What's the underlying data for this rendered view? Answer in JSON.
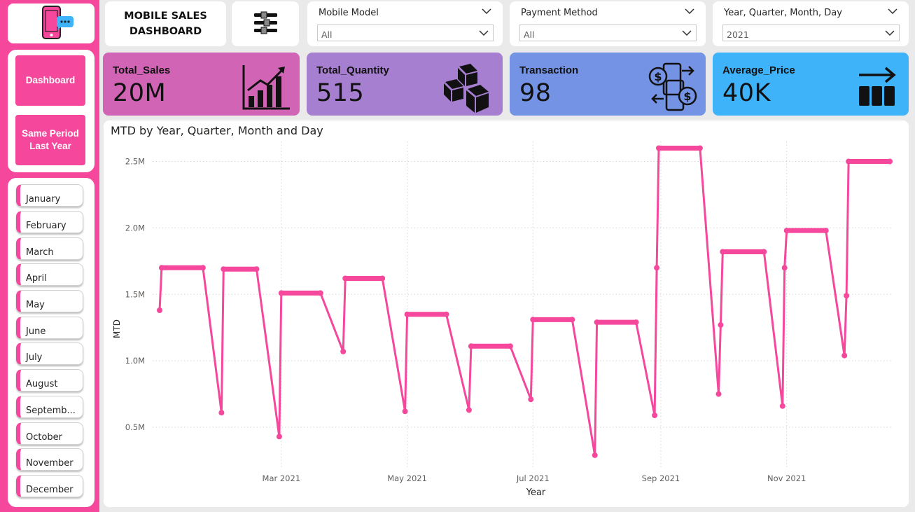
{
  "header": {
    "title_line1": "MOBILE SALES",
    "title_line2": "DASHBOARD"
  },
  "nav": {
    "dashboard_label": "Dashboard",
    "same_period_label": "Same Period Last Year"
  },
  "months": [
    "January",
    "February",
    "March",
    "April",
    "May",
    "June",
    "July",
    "August",
    "Septemb...",
    "October",
    "November",
    "December"
  ],
  "slicers": [
    {
      "title": "Mobile Model",
      "value": "All"
    },
    {
      "title": "Payment Method",
      "value": "All"
    },
    {
      "title": "Year, Quarter, Month, Day",
      "value": "2021"
    }
  ],
  "kpis": [
    {
      "label": "Total_Sales",
      "value": "20M",
      "color": "#d264b6",
      "icon": "bar-growth-chart-icon"
    },
    {
      "label": "Total_Quantity",
      "value": "515",
      "color": "#a77fd0",
      "icon": "boxes-icon"
    },
    {
      "label": "Transaction",
      "value": "98",
      "color": "#7593e5",
      "icon": "money-transfer-icon"
    },
    {
      "label": "Average_Price",
      "value": "40K",
      "color": "#3fb3f9",
      "icon": "arrow-bars-icon"
    }
  ],
  "colors": {
    "sidebar": "#f5489c",
    "line": "#f5489c"
  },
  "chart_data": {
    "type": "line",
    "title": "MTD by Year, Quarter, Month and Day",
    "xlabel": "Year",
    "ylabel": "MTD",
    "x_ticks": [
      "Mar 2021",
      "May 2021",
      "Jul 2021",
      "Sep 2021",
      "Nov 2021"
    ],
    "y_ticks": [
      "0.5M",
      "1.0M",
      "1.5M",
      "2.0M",
      "2.5M"
    ],
    "ylim": [
      0.2,
      2.65
    ],
    "grid": true,
    "series": [
      {
        "points": [
          [
            "2021-01-01",
            1.38
          ],
          [
            "2021-01-02",
            1.7
          ],
          [
            "2021-01-22",
            1.7
          ],
          [
            "2021-01-31",
            0.61
          ],
          [
            "2021-02-01",
            1.69
          ],
          [
            "2021-02-17",
            1.69
          ],
          [
            "2021-02-28",
            0.43
          ],
          [
            "2021-03-01",
            1.51
          ],
          [
            "2021-03-20",
            1.51
          ],
          [
            "2021-03-31",
            1.07
          ],
          [
            "2021-04-01",
            1.62
          ],
          [
            "2021-04-19",
            1.62
          ],
          [
            "2021-04-30",
            0.62
          ],
          [
            "2021-05-01",
            1.35
          ],
          [
            "2021-05-20",
            1.35
          ],
          [
            "2021-05-31",
            0.63
          ],
          [
            "2021-06-01",
            1.11
          ],
          [
            "2021-06-20",
            1.11
          ],
          [
            "2021-06-30",
            0.71
          ],
          [
            "2021-07-01",
            1.31
          ],
          [
            "2021-07-20",
            1.31
          ],
          [
            "2021-07-31",
            0.29
          ],
          [
            "2021-08-01",
            1.29
          ],
          [
            "2021-08-20",
            1.29
          ],
          [
            "2021-08-29",
            0.59
          ],
          [
            "2021-08-30",
            1.7
          ],
          [
            "2021-08-31",
            2.6
          ],
          [
            "2021-09-20",
            2.6
          ],
          [
            "2021-09-29",
            0.75
          ],
          [
            "2021-09-30",
            1.27
          ],
          [
            "2021-10-01",
            1.82
          ],
          [
            "2021-10-21",
            1.82
          ],
          [
            "2021-10-30",
            0.66
          ],
          [
            "2021-10-31",
            1.7
          ],
          [
            "2021-11-01",
            1.98
          ],
          [
            "2021-11-20",
            1.98
          ],
          [
            "2021-11-29",
            1.04
          ],
          [
            "2021-11-30",
            1.49
          ],
          [
            "2021-12-01",
            2.5
          ],
          [
            "2021-12-21",
            2.5
          ]
        ]
      }
    ]
  }
}
